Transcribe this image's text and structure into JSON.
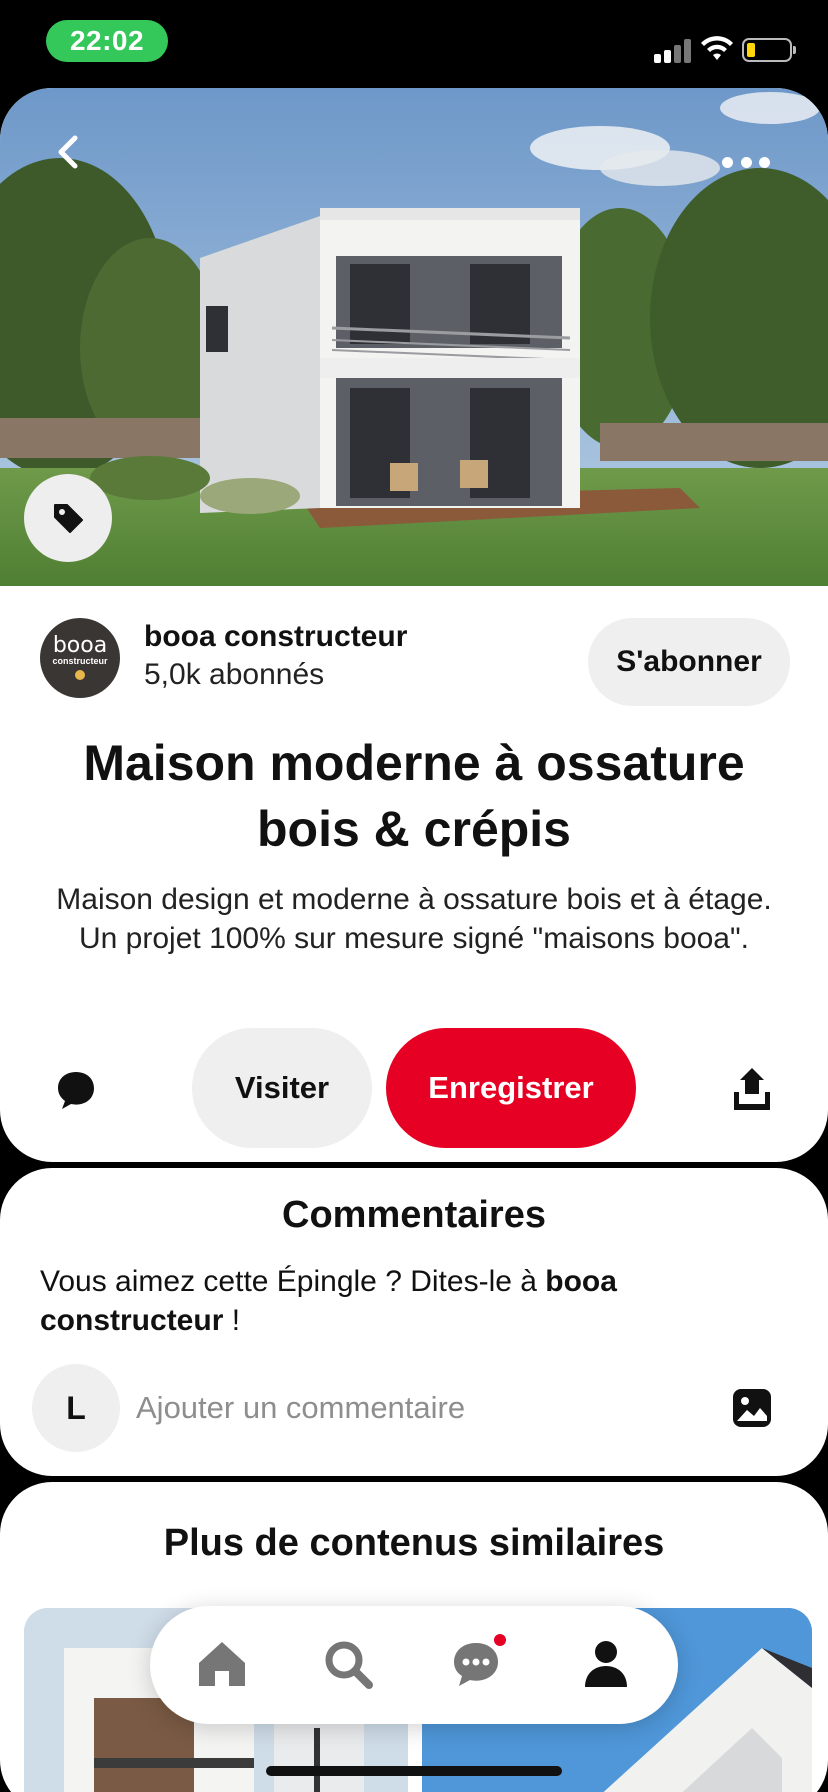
{
  "status_bar": {
    "time": "22:02",
    "signal_icon": "cellular-signal-icon",
    "wifi_icon": "wifi-icon",
    "battery_icon": "battery-low-icon"
  },
  "pin": {
    "back_icon": "chevron-left-icon",
    "more_icon": "more-horizontal-icon",
    "tag_icon": "tag-icon",
    "creator": {
      "name": "booa constructeur",
      "followers": "5,0k abonnés",
      "avatar_text": "booa",
      "avatar_subtext": "constructeur"
    },
    "follow_label": "S'abonner",
    "title": "Maison moderne à ossature bois & crépis",
    "description": "Maison design et moderne à ossature bois et à étage. Un projet 100% sur mesure signé \"maisons booa\".",
    "actions": {
      "comment_icon": "comment-bubble-icon",
      "visit_label": "Visiter",
      "save_label": "Enregistrer",
      "share_icon": "share-icon"
    },
    "colors": {
      "save_button": "#e60023",
      "secondary_button": "#efefef"
    }
  },
  "comments": {
    "title": "Commentaires",
    "prompt_prefix": "Vous aimez cette Épingle ? Dites-le à ",
    "prompt_name": "booa constructeur",
    "prompt_suffix": " !",
    "user_initial": "L",
    "input_placeholder": "Ajouter un commentaire",
    "image_icon": "image-icon"
  },
  "similar": {
    "title": "Plus de contenus similaires"
  },
  "bottom_nav": {
    "items": [
      {
        "icon": "home-icon"
      },
      {
        "icon": "search-icon"
      },
      {
        "icon": "messages-icon",
        "has_notification": true
      },
      {
        "icon": "profile-icon"
      }
    ]
  }
}
